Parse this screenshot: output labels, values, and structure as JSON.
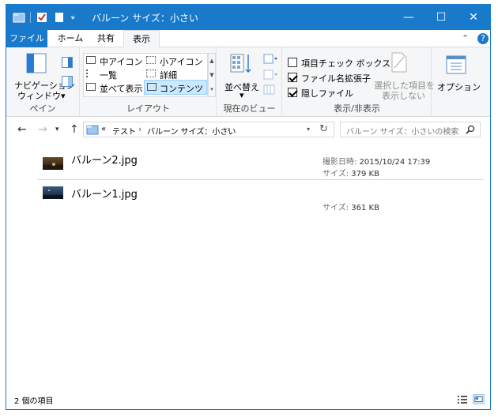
{
  "window": {
    "title": "バルーン サイズ：小さい",
    "controls": {
      "minimize": "—",
      "maximize": "☐",
      "close": "✕"
    }
  },
  "ribbon_tabs": [
    "ファイル",
    "ホーム",
    "共有",
    "表示"
  ],
  "ribbon_tabs_right": {
    "collapse": "⌃",
    "help": "?"
  },
  "ribbon": {
    "panes": {
      "nav_pane_line1": "ナビゲーション",
      "nav_pane_line2": "ウィンドウ▾",
      "label": "ペイン"
    },
    "layout": {
      "items": [
        "中アイコン",
        "小アイコン",
        "一覧",
        "詳細",
        "並べて表示",
        "コンテンツ"
      ],
      "selected": "コンテンツ",
      "label": "レイアウト"
    },
    "current_view": {
      "sort_line1": "並べ替え",
      "sort_line2": "▾",
      "label": "現在のビュー"
    },
    "show_hide": {
      "checkbox_item": "項目チェック ボックス",
      "checkbox_item_checked": false,
      "ext": "ファイル名拡張子",
      "ext_checked": true,
      "hidden": "隠しファイル",
      "hidden_checked": true,
      "hide_selected_line1": "選択した項目を",
      "hide_selected_line2": "表示しない",
      "label": "表示/非表示"
    },
    "options": "オプション"
  },
  "address_bar": {
    "prefix": "«",
    "crumbs": [
      "テスト",
      "バルーン サイズ：小さい"
    ],
    "separator": "›",
    "search_placeholder": "バルーン サイズ：小さいの検索"
  },
  "files": [
    {
      "name": "バルーン2.jpg",
      "date_label": "撮影日時:",
      "date": "2015/10/24 17:39",
      "size_label": "サイズ:",
      "size": "379 KB"
    },
    {
      "name": "バルーン1.jpg",
      "size_label": "サイズ:",
      "size": "361 KB"
    }
  ],
  "status": {
    "count": "2 個の項目"
  },
  "colors": {
    "accent": "#1979ca",
    "selected": "#cce8ff",
    "selected_border": "#99d1ff"
  }
}
